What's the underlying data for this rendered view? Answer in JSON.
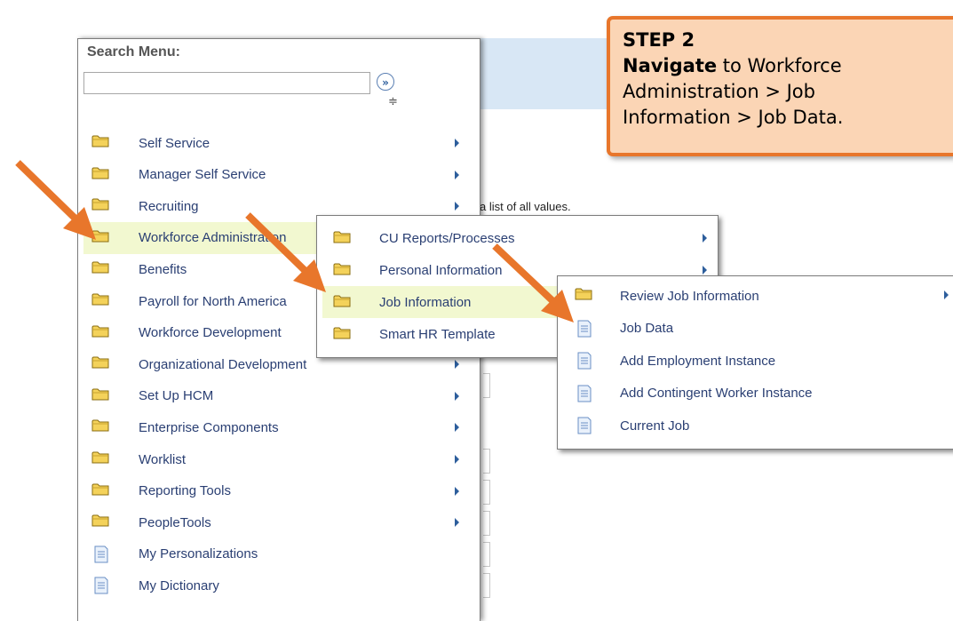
{
  "colors": {
    "accent_arrow": "#e8762b",
    "callout_fill": "#fbd5b5",
    "menu_text": "#2a3f73",
    "highlight": "#f2f8d0"
  },
  "background": {
    "hint_text": "a list of all values."
  },
  "search": {
    "label": "Search Menu:",
    "value": "",
    "placeholder": "",
    "go_icon": "double-chevron-right-icon",
    "go_glyph": "»",
    "sort_icon": "sort-arrows-icon",
    "sort_glyph": "≑"
  },
  "main_menu": {
    "items": [
      {
        "label": "Self Service",
        "icon": "folder-icon",
        "has_submenu": true
      },
      {
        "label": "Manager Self Service",
        "icon": "folder-icon",
        "has_submenu": true
      },
      {
        "label": "Recruiting",
        "icon": "folder-icon",
        "has_submenu": true
      },
      {
        "label": "Workforce Administration",
        "icon": "folder-icon",
        "has_submenu": true,
        "highlighted": true
      },
      {
        "label": "Benefits",
        "icon": "folder-icon",
        "has_submenu": true
      },
      {
        "label": "Payroll for North America",
        "icon": "folder-icon",
        "has_submenu": true
      },
      {
        "label": "Workforce Development",
        "icon": "folder-icon",
        "has_submenu": true
      },
      {
        "label": "Organizational Development",
        "icon": "folder-icon",
        "has_submenu": true
      },
      {
        "label": "Set Up HCM",
        "icon": "folder-icon",
        "has_submenu": true
      },
      {
        "label": "Enterprise Components",
        "icon": "folder-icon",
        "has_submenu": true
      },
      {
        "label": "Worklist",
        "icon": "folder-icon",
        "has_submenu": true
      },
      {
        "label": "Reporting Tools",
        "icon": "folder-icon",
        "has_submenu": true
      },
      {
        "label": "PeopleTools",
        "icon": "folder-icon",
        "has_submenu": true
      },
      {
        "label": "My Personalizations",
        "icon": "document-icon",
        "has_submenu": false
      },
      {
        "label": "My Dictionary",
        "icon": "document-icon",
        "has_submenu": false
      }
    ]
  },
  "workforce_submenu": {
    "items": [
      {
        "label": "CU Reports/Processes",
        "icon": "folder-icon",
        "has_submenu": true
      },
      {
        "label": "Personal Information",
        "icon": "folder-icon",
        "has_submenu": true
      },
      {
        "label": "Job Information",
        "icon": "folder-icon",
        "has_submenu": false,
        "highlighted": true
      },
      {
        "label": "Smart HR Template",
        "icon": "folder-icon",
        "has_submenu": false
      }
    ]
  },
  "job_info_submenu": {
    "items": [
      {
        "label": "Review Job Information",
        "icon": "folder-icon",
        "has_submenu": true
      },
      {
        "label": "Job Data",
        "icon": "document-icon",
        "has_submenu": false
      },
      {
        "label": "Add Employment Instance",
        "icon": "document-icon",
        "has_submenu": false
      },
      {
        "label": "Add Contingent Worker Instance",
        "icon": "document-icon",
        "has_submenu": false
      },
      {
        "label": "Current Job",
        "icon": "document-icon",
        "has_submenu": false
      }
    ]
  },
  "callout": {
    "step": "STEP 2",
    "verb": "Navigate",
    "text_1": " to Workforce",
    "text_2": "Administration > Job",
    "text_3": "Information > Job Data."
  }
}
